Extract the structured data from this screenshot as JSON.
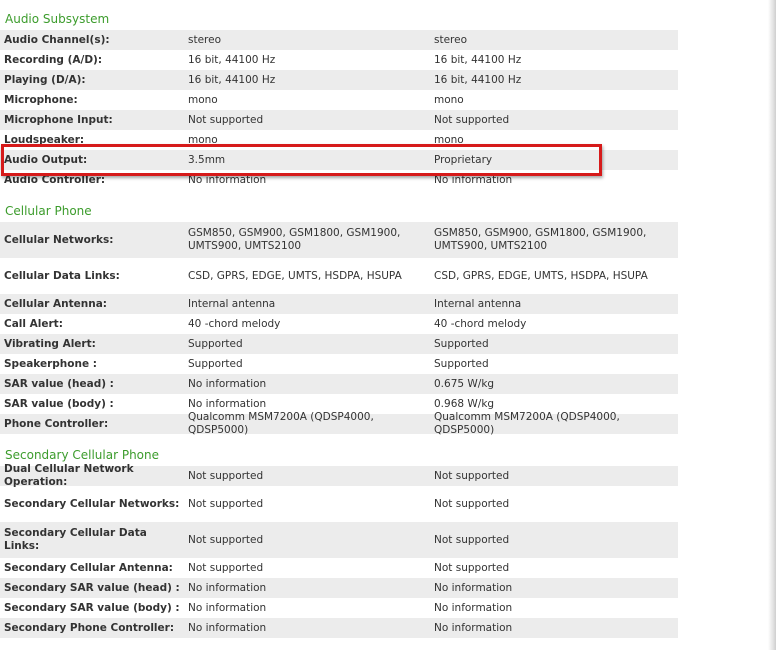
{
  "sections": [
    {
      "title": "Audio Subsystem",
      "rows": [
        {
          "label": "Audio Channel(s):",
          "v1": "stereo",
          "v2": "stereo"
        },
        {
          "label": "Recording (A/D):",
          "v1": "16 bit, 44100 Hz",
          "v2": "16 bit, 44100 Hz"
        },
        {
          "label": "Playing (D/A):",
          "v1": "16 bit, 44100 Hz",
          "v2": "16 bit, 44100 Hz"
        },
        {
          "label": "Microphone:",
          "v1": "mono",
          "v2": "mono"
        },
        {
          "label": "Microphone Input:",
          "v1": "Not supported",
          "v2": "Not supported"
        },
        {
          "label": "Loudspeaker:",
          "v1": "mono",
          "v2": "mono"
        },
        {
          "label": "Audio Output:",
          "v1": "3.5mm",
          "v2": "Proprietary"
        },
        {
          "label": "Audio Controller:",
          "v1": "No information",
          "v2": "No information"
        }
      ]
    },
    {
      "title": "Cellular Phone",
      "rows": [
        {
          "label": "Cellular Networks:",
          "v1": "GSM850, GSM900, GSM1800, GSM1900, UMTS900, UMTS2100",
          "v2": "GSM850, GSM900, GSM1800, GSM1900, UMTS900, UMTS2100"
        },
        {
          "label": "Cellular Data Links:",
          "v1": "CSD, GPRS, EDGE, UMTS, HSDPA, HSUPA",
          "v2": "CSD, GPRS, EDGE, UMTS, HSDPA, HSUPA"
        },
        {
          "label": "Cellular Antenna:",
          "v1": "Internal antenna",
          "v2": "Internal antenna"
        },
        {
          "label": "Call Alert:",
          "v1": "40 -chord melody",
          "v2": "40 -chord melody"
        },
        {
          "label": "Vibrating Alert:",
          "v1": "Supported",
          "v2": "Supported"
        },
        {
          "label": "Speakerphone :",
          "v1": "Supported",
          "v2": "Supported"
        },
        {
          "label": "SAR value (head) :",
          "v1": "No information",
          "v2": "0.675 W/kg"
        },
        {
          "label": "SAR value (body) :",
          "v1": "No information",
          "v2": "0.968 W/kg"
        },
        {
          "label": "Phone Controller:",
          "v1": "Qualcomm MSM7200A (QDSP4000, QDSP5000)",
          "v2": "Qualcomm MSM7200A (QDSP4000, QDSP5000)"
        }
      ]
    },
    {
      "title": "Secondary Cellular Phone",
      "rows": [
        {
          "label": "Dual Cellular Network Operation:",
          "v1": "Not supported",
          "v2": "Not supported"
        },
        {
          "label": "Secondary Cellular Networks:",
          "v1": "Not supported",
          "v2": "Not supported"
        },
        {
          "label": "Secondary Cellular Data Links:",
          "v1": "Not supported",
          "v2": "Not supported"
        },
        {
          "label": "Secondary Cellular Antenna:",
          "v1": "Not supported",
          "v2": "Not supported"
        },
        {
          "label": "Secondary SAR value (head) :",
          "v1": "No information",
          "v2": "No information"
        },
        {
          "label": "Secondary SAR value (body) :",
          "v1": "No information",
          "v2": "No information"
        },
        {
          "label": "Secondary Phone Controller:",
          "v1": "No information",
          "v2": "No information"
        }
      ]
    }
  ],
  "colors": {
    "section_title": "#3c9c2c",
    "highlight": "#d61a1a",
    "row_shade": "#ececec"
  }
}
